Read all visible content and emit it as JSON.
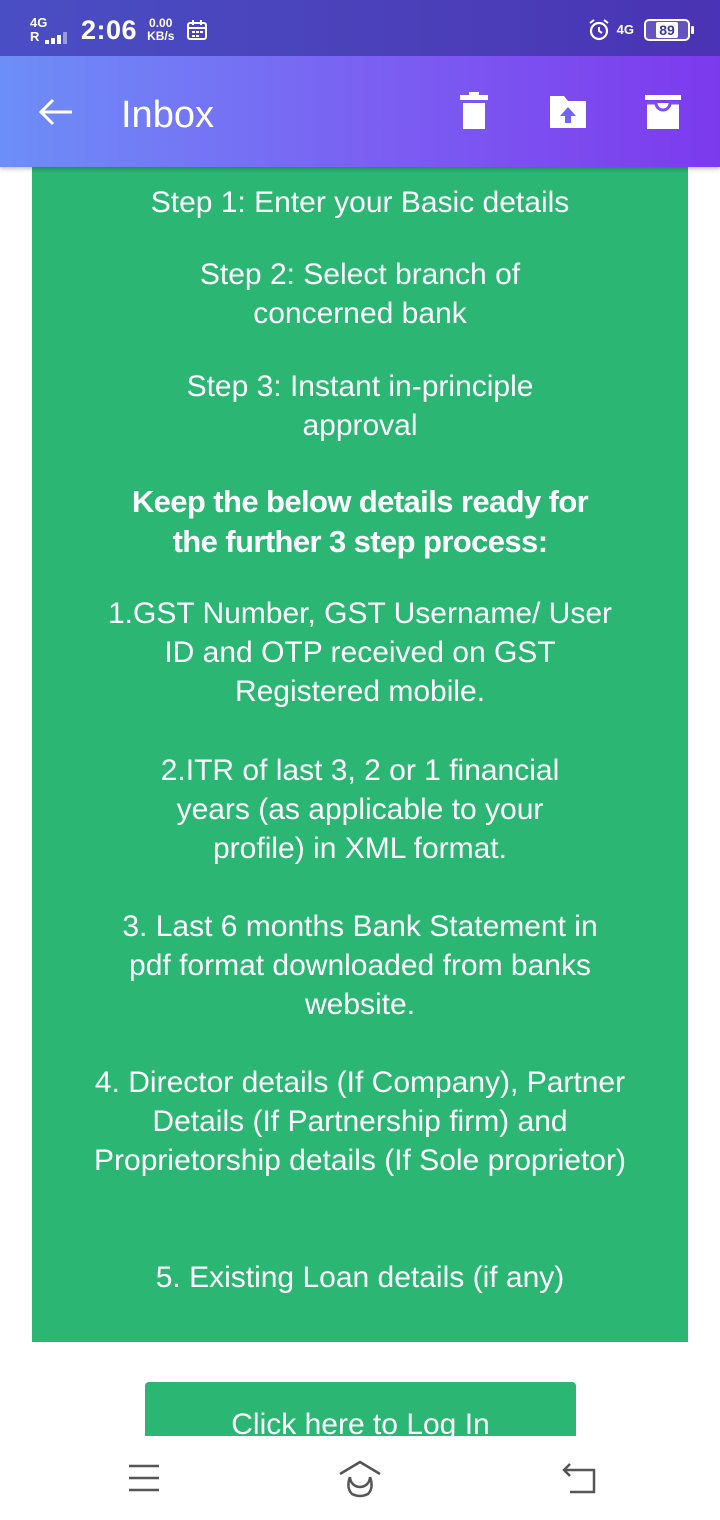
{
  "status_bar": {
    "network_type": "4G",
    "roaming": "R",
    "time": "2:06",
    "speed_value": "0.00",
    "speed_unit": "KB/s",
    "network_type_right": "4G",
    "battery_level": "89"
  },
  "app_bar": {
    "title": "Inbox",
    "icons": [
      "back-arrow-icon",
      "delete-icon",
      "move-to-folder-icon",
      "archive-icon"
    ]
  },
  "content": {
    "steps": [
      "Step 1: Enter your Basic details",
      "Step 2: Select branch of concerned bank",
      "Step 3: Instant in-principle approval"
    ],
    "heading": "Keep the below details ready for the further 3 step process:",
    "items": [
      "1.GST Number, GST Username/ User ID and OTP received on GST Registered mobile.",
      "2.ITR of last 3, 2 or 1 financial years (as applicable to your profile) in XML format.",
      "3. Last 6 months Bank Statement in pdf format downloaded from banks website.",
      "4. Director details (If Company), Partner Details (If Partnership firm) and Proprietorship details (If Sole proprietor)",
      "5. Existing Loan details (if any)"
    ],
    "login_button": "Click here to Log In",
    "panel_color": "#2bb673"
  },
  "nav_bar": {
    "icons": [
      "menu-icon",
      "home-icon",
      "back-icon"
    ]
  }
}
